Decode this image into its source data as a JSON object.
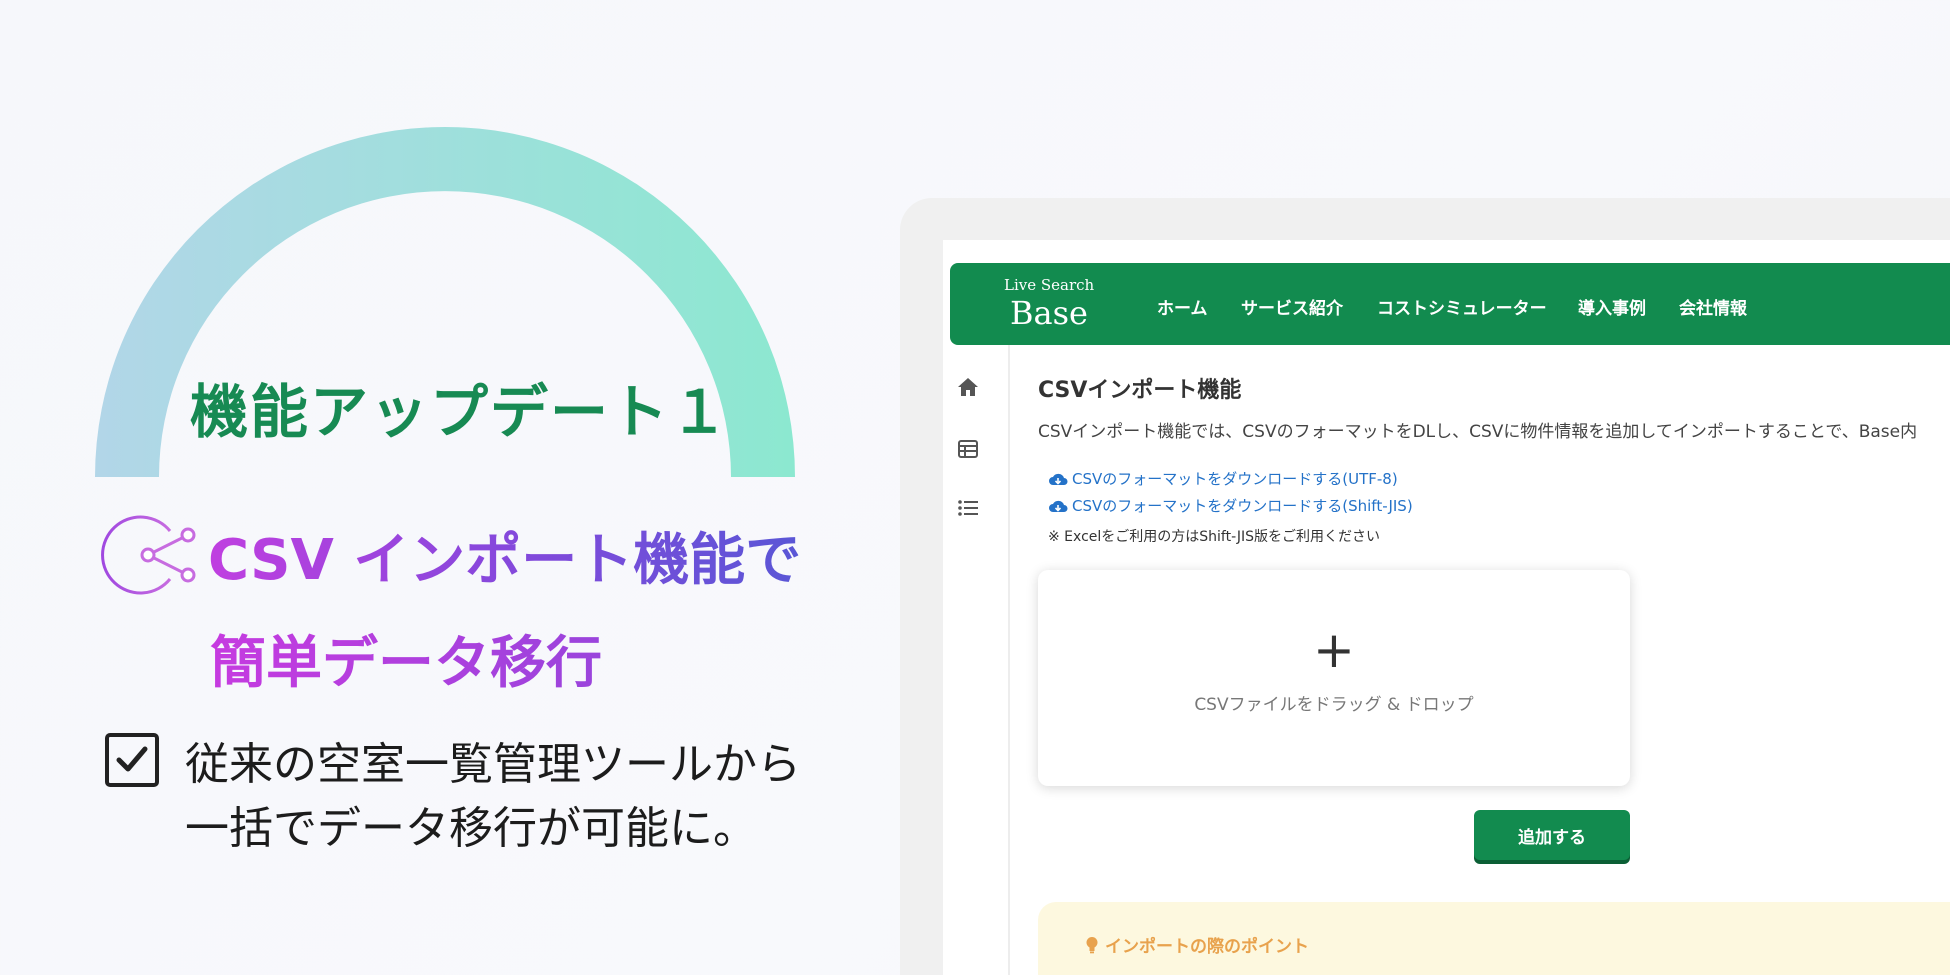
{
  "hero": {
    "badge_title": "機能アップデート１",
    "headline_line1": "CSV インポート機能で",
    "headline_line2": "簡単データ移行",
    "description_line1": "従来の空室一覧管理ツールから",
    "description_line2": "一括でデータ移行が可能に。",
    "icons": [
      "share-icon",
      "checkbox-icon"
    ]
  },
  "app": {
    "logo_small": "Live Search",
    "logo_big": "Base",
    "nav": [
      "ホーム",
      "サービス紹介",
      "コストシミュレーター",
      "導入事例",
      "会社情報"
    ],
    "sidebar_icons": [
      "home-icon",
      "table-icon",
      "list-icon"
    ],
    "page_title": "CSVインポート機能",
    "page_intro": "CSVインポート機能では、CSVのフォーマットをDLし、CSVに物件情報を追加してインポートすることで、Base内",
    "links": [
      "CSVのフォーマットをダウンロードする(UTF-8)",
      "CSVのフォーマットをダウンロードする(Shift-JIS)"
    ],
    "note": "※ Excelをご利用の方はShift-JIS版をご利用ください",
    "dropzone_plus": "+",
    "dropzone_text": "CSVファイルをドラッグ & ドロップ",
    "add_button": "追加する",
    "tips_title": "インポートの際のポイント"
  },
  "colors": {
    "brand_green": "#128b4f",
    "headline_magenta": "#c03fe0",
    "headline_indigo": "#5a56d6",
    "link_blue": "#2472c8",
    "tips_orange": "#e8a24d"
  }
}
